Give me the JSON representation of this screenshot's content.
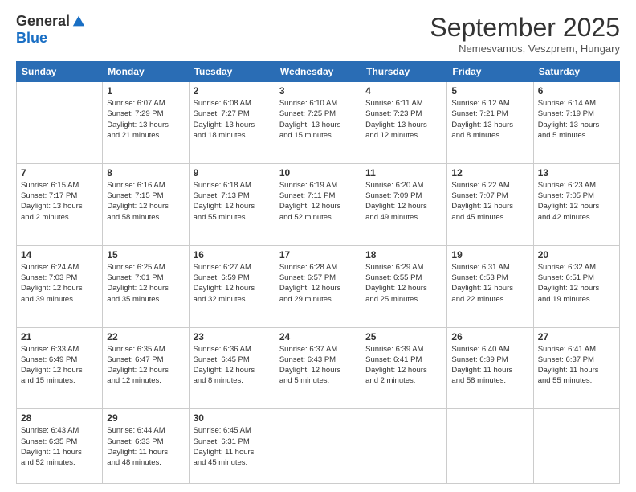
{
  "logo": {
    "general": "General",
    "blue": "Blue"
  },
  "title": "September 2025",
  "location": "Nemesvamos, Veszprem, Hungary",
  "days_of_week": [
    "Sunday",
    "Monday",
    "Tuesday",
    "Wednesday",
    "Thursday",
    "Friday",
    "Saturday"
  ],
  "weeks": [
    [
      {
        "day": "",
        "info": ""
      },
      {
        "day": "1",
        "info": "Sunrise: 6:07 AM\nSunset: 7:29 PM\nDaylight: 13 hours\nand 21 minutes."
      },
      {
        "day": "2",
        "info": "Sunrise: 6:08 AM\nSunset: 7:27 PM\nDaylight: 13 hours\nand 18 minutes."
      },
      {
        "day": "3",
        "info": "Sunrise: 6:10 AM\nSunset: 7:25 PM\nDaylight: 13 hours\nand 15 minutes."
      },
      {
        "day": "4",
        "info": "Sunrise: 6:11 AM\nSunset: 7:23 PM\nDaylight: 13 hours\nand 12 minutes."
      },
      {
        "day": "5",
        "info": "Sunrise: 6:12 AM\nSunset: 7:21 PM\nDaylight: 13 hours\nand 8 minutes."
      },
      {
        "day": "6",
        "info": "Sunrise: 6:14 AM\nSunset: 7:19 PM\nDaylight: 13 hours\nand 5 minutes."
      }
    ],
    [
      {
        "day": "7",
        "info": "Sunrise: 6:15 AM\nSunset: 7:17 PM\nDaylight: 13 hours\nand 2 minutes."
      },
      {
        "day": "8",
        "info": "Sunrise: 6:16 AM\nSunset: 7:15 PM\nDaylight: 12 hours\nand 58 minutes."
      },
      {
        "day": "9",
        "info": "Sunrise: 6:18 AM\nSunset: 7:13 PM\nDaylight: 12 hours\nand 55 minutes."
      },
      {
        "day": "10",
        "info": "Sunrise: 6:19 AM\nSunset: 7:11 PM\nDaylight: 12 hours\nand 52 minutes."
      },
      {
        "day": "11",
        "info": "Sunrise: 6:20 AM\nSunset: 7:09 PM\nDaylight: 12 hours\nand 49 minutes."
      },
      {
        "day": "12",
        "info": "Sunrise: 6:22 AM\nSunset: 7:07 PM\nDaylight: 12 hours\nand 45 minutes."
      },
      {
        "day": "13",
        "info": "Sunrise: 6:23 AM\nSunset: 7:05 PM\nDaylight: 12 hours\nand 42 minutes."
      }
    ],
    [
      {
        "day": "14",
        "info": "Sunrise: 6:24 AM\nSunset: 7:03 PM\nDaylight: 12 hours\nand 39 minutes."
      },
      {
        "day": "15",
        "info": "Sunrise: 6:25 AM\nSunset: 7:01 PM\nDaylight: 12 hours\nand 35 minutes."
      },
      {
        "day": "16",
        "info": "Sunrise: 6:27 AM\nSunset: 6:59 PM\nDaylight: 12 hours\nand 32 minutes."
      },
      {
        "day": "17",
        "info": "Sunrise: 6:28 AM\nSunset: 6:57 PM\nDaylight: 12 hours\nand 29 minutes."
      },
      {
        "day": "18",
        "info": "Sunrise: 6:29 AM\nSunset: 6:55 PM\nDaylight: 12 hours\nand 25 minutes."
      },
      {
        "day": "19",
        "info": "Sunrise: 6:31 AM\nSunset: 6:53 PM\nDaylight: 12 hours\nand 22 minutes."
      },
      {
        "day": "20",
        "info": "Sunrise: 6:32 AM\nSunset: 6:51 PM\nDaylight: 12 hours\nand 19 minutes."
      }
    ],
    [
      {
        "day": "21",
        "info": "Sunrise: 6:33 AM\nSunset: 6:49 PM\nDaylight: 12 hours\nand 15 minutes."
      },
      {
        "day": "22",
        "info": "Sunrise: 6:35 AM\nSunset: 6:47 PM\nDaylight: 12 hours\nand 12 minutes."
      },
      {
        "day": "23",
        "info": "Sunrise: 6:36 AM\nSunset: 6:45 PM\nDaylight: 12 hours\nand 8 minutes."
      },
      {
        "day": "24",
        "info": "Sunrise: 6:37 AM\nSunset: 6:43 PM\nDaylight: 12 hours\nand 5 minutes."
      },
      {
        "day": "25",
        "info": "Sunrise: 6:39 AM\nSunset: 6:41 PM\nDaylight: 12 hours\nand 2 minutes."
      },
      {
        "day": "26",
        "info": "Sunrise: 6:40 AM\nSunset: 6:39 PM\nDaylight: 11 hours\nand 58 minutes."
      },
      {
        "day": "27",
        "info": "Sunrise: 6:41 AM\nSunset: 6:37 PM\nDaylight: 11 hours\nand 55 minutes."
      }
    ],
    [
      {
        "day": "28",
        "info": "Sunrise: 6:43 AM\nSunset: 6:35 PM\nDaylight: 11 hours\nand 52 minutes."
      },
      {
        "day": "29",
        "info": "Sunrise: 6:44 AM\nSunset: 6:33 PM\nDaylight: 11 hours\nand 48 minutes."
      },
      {
        "day": "30",
        "info": "Sunrise: 6:45 AM\nSunset: 6:31 PM\nDaylight: 11 hours\nand 45 minutes."
      },
      {
        "day": "",
        "info": ""
      },
      {
        "day": "",
        "info": ""
      },
      {
        "day": "",
        "info": ""
      },
      {
        "day": "",
        "info": ""
      }
    ]
  ]
}
